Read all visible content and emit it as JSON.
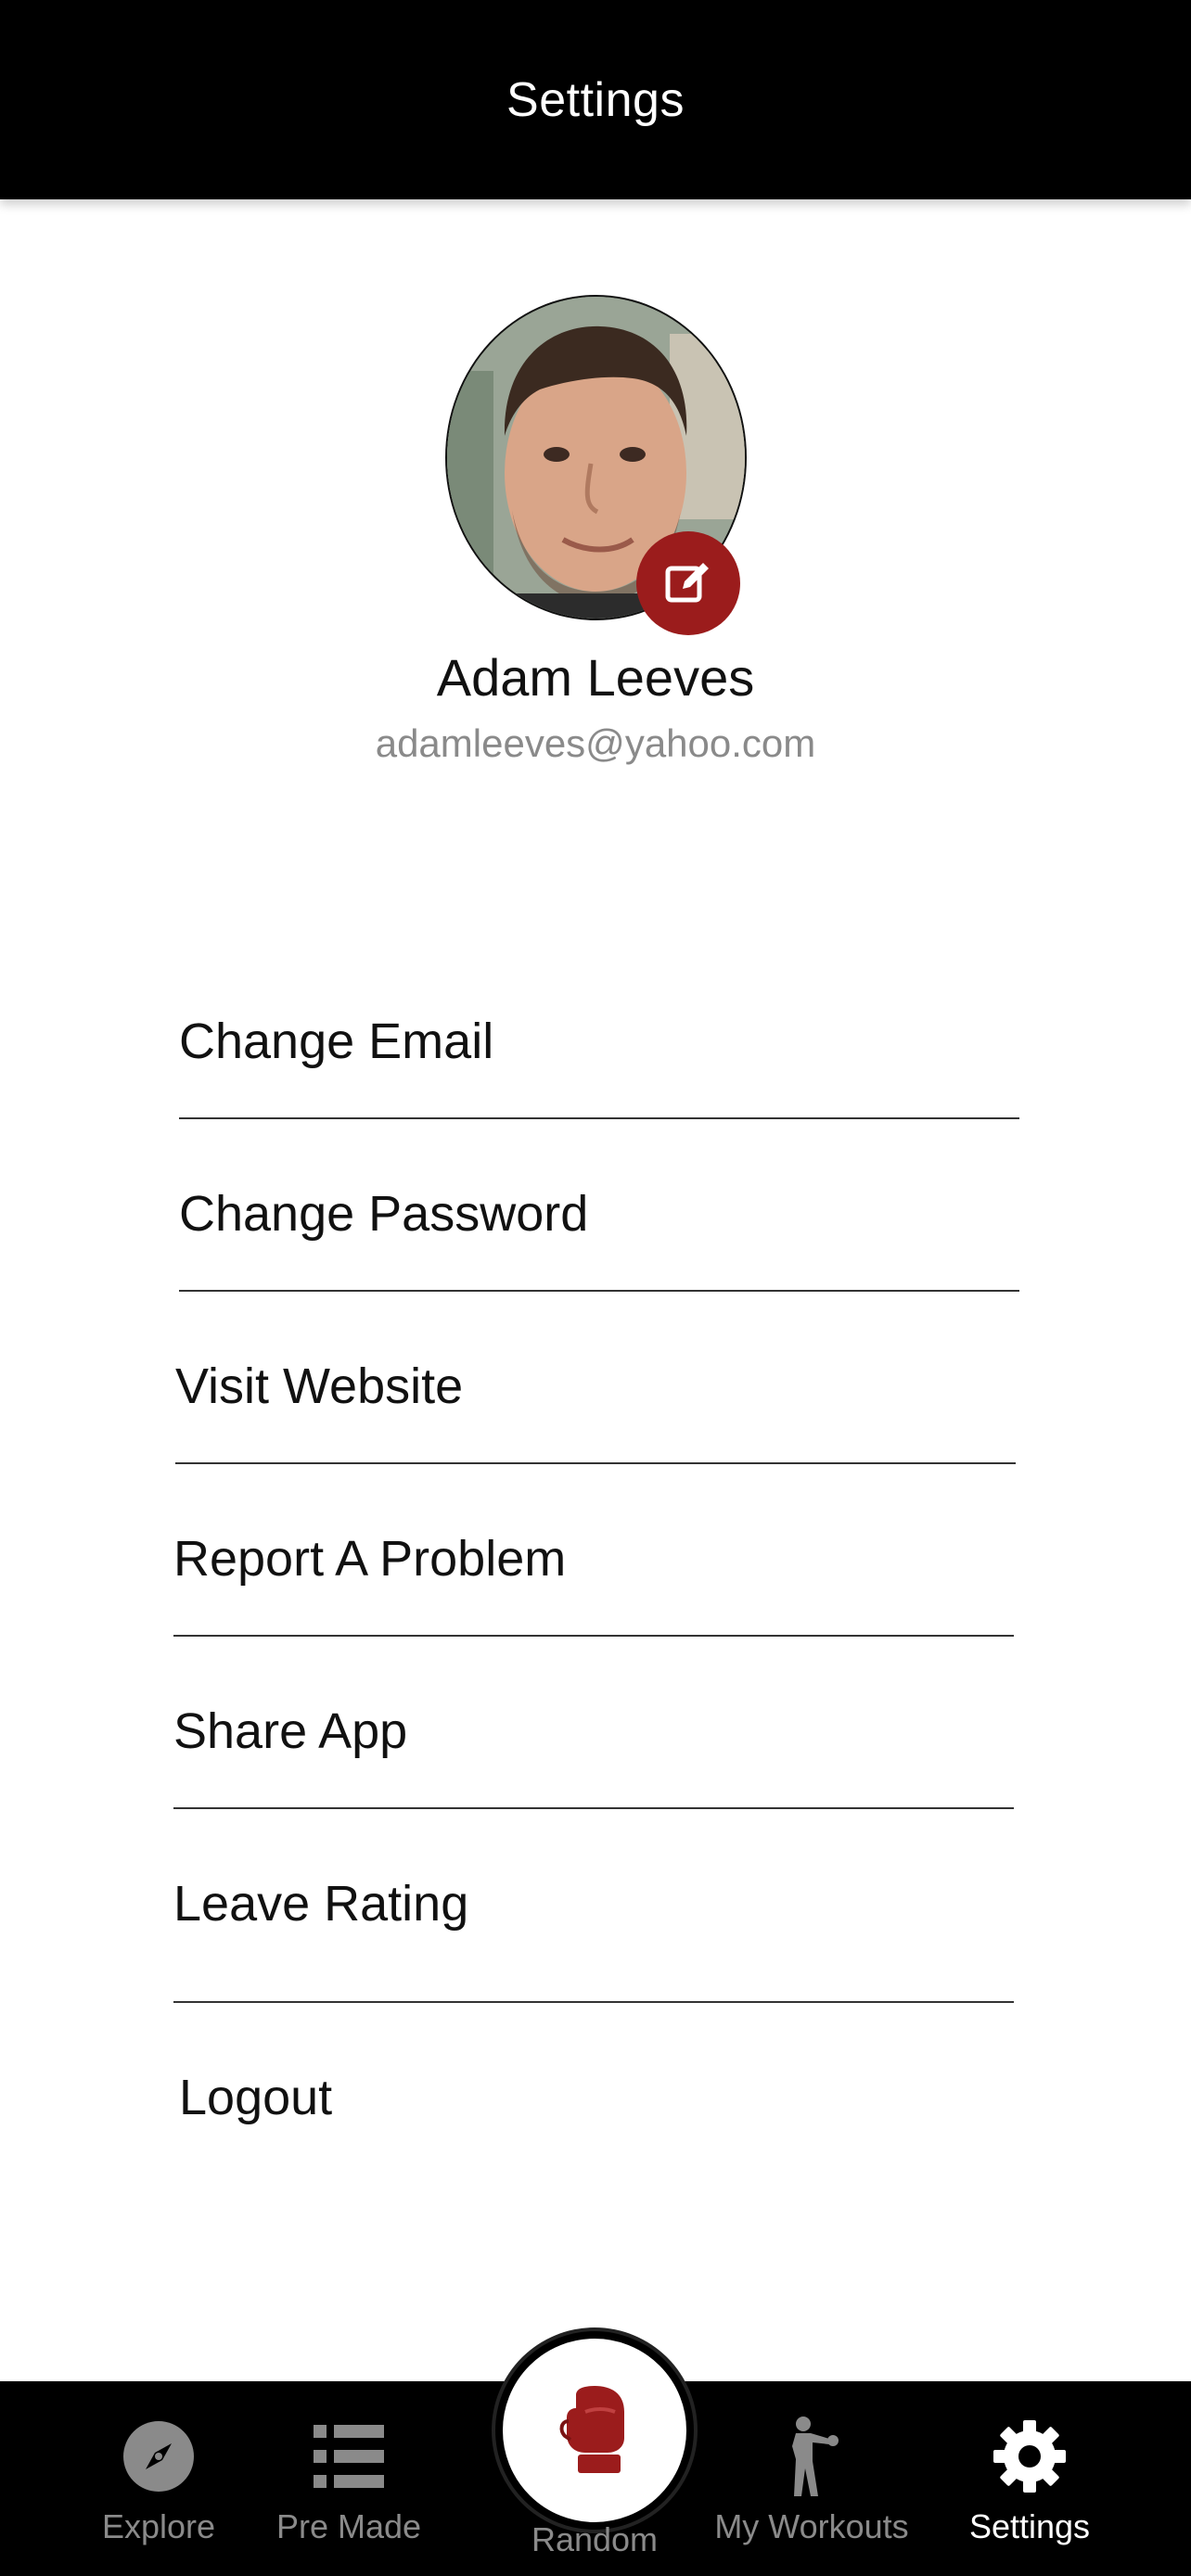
{
  "header": {
    "title": "Settings"
  },
  "profile": {
    "name": "Adam Leeves",
    "email": "adamleeves@yahoo.com"
  },
  "menu": [
    {
      "label": "Change Email"
    },
    {
      "label": "Change Password"
    },
    {
      "label": "Visit Website"
    },
    {
      "label": "Report A Problem"
    },
    {
      "label": "Share App"
    },
    {
      "label": "Leave Rating"
    },
    {
      "label": "Logout"
    }
  ],
  "nav": {
    "explore": "Explore",
    "premade": "Pre Made",
    "random": "Random",
    "myworkouts": "My Workouts",
    "settings": "Settings",
    "active": "Settings"
  },
  "colors": {
    "accent": "#9b1c1c",
    "header_bg": "#000000",
    "nav_inactive": "#8a8a8a",
    "nav_active": "#ffffff"
  },
  "icons": {
    "edit": "edit-icon",
    "explore": "compass-icon",
    "premade": "list-icon",
    "random": "boxing-glove-icon",
    "myworkouts": "boxer-icon",
    "settings": "gear-icon"
  }
}
